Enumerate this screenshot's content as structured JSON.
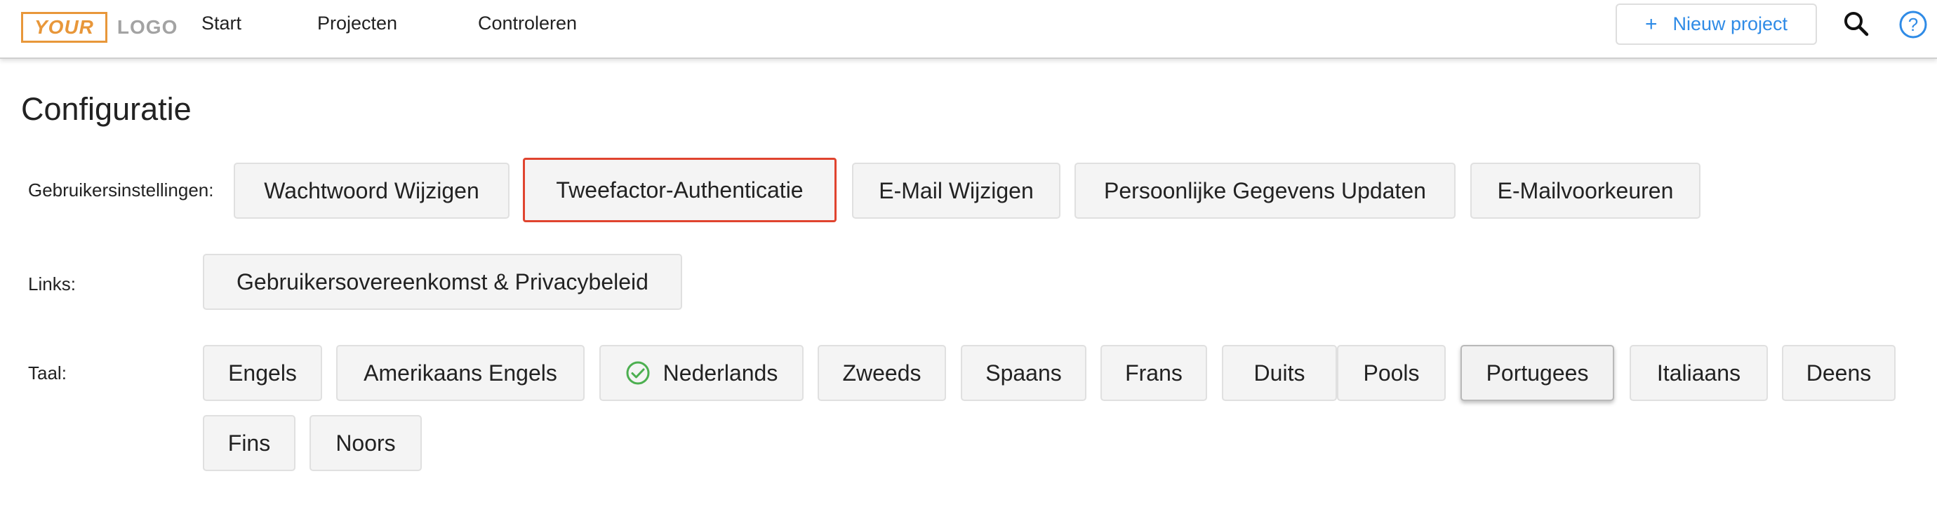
{
  "header": {
    "logo_your": "YOUR",
    "logo_logo": "LOGO",
    "nav": [
      "Start",
      "Projecten",
      "Controleren"
    ],
    "new_project_label": "Nieuw project",
    "search_icon": "search-icon",
    "help_icon": "help-icon"
  },
  "page": {
    "title": "Configuratie"
  },
  "user_settings": {
    "label": "Gebruikersinstellingen:",
    "buttons": [
      "Wachtwoord Wijzigen",
      "Tweefactor-Authenticatie",
      "E-Mail Wijzigen",
      "Persoonlijke Gegevens Updaten",
      "E-Mailvoorkeuren"
    ],
    "highlighted": "Tweefactor-Authenticatie"
  },
  "links": {
    "label": "Links:",
    "buttons": [
      "Gebruikersovereenkomst & Privacybeleid"
    ]
  },
  "language": {
    "label": "Taal:",
    "options": [
      "Engels",
      "Amerikaans Engels",
      "Nederlands",
      "Zweeds",
      "Spaans",
      "Frans",
      "Duits",
      "Pools",
      "Portugees",
      "Italiaans",
      "Deens",
      "Fins",
      "Noors"
    ],
    "selected": "Nederlands",
    "pressed": "Portugees"
  },
  "colors": {
    "logo_accent": "#e8973a",
    "link_blue": "#2f8be6",
    "highlight_red": "#e0442f",
    "check_green": "#4caf50"
  }
}
